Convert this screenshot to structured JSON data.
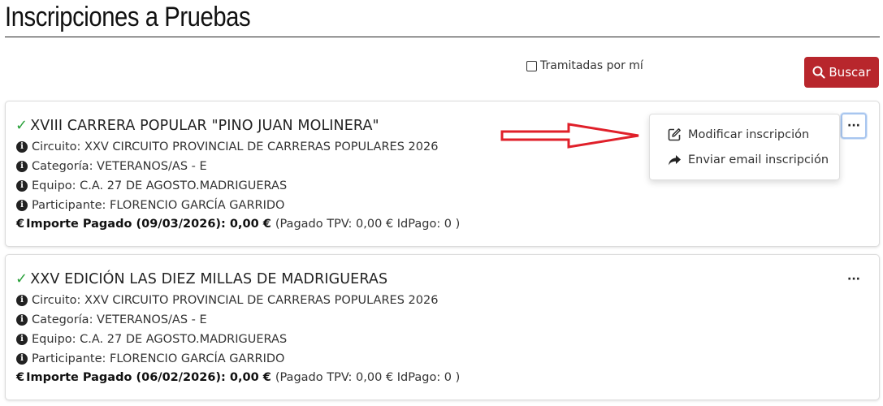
{
  "header": {
    "title": "Inscripciones a Pruebas"
  },
  "filters": {
    "checkbox_label": "Tramitadas por mí",
    "search_label": "Buscar"
  },
  "cards": [
    {
      "title": "XVIII CARRERA POPULAR \"PINO JUAN MOLINERA\"",
      "circuito": "Circuito: XXV CIRCUITO  PROVINCIAL  DE CARRERAS  POPULARES 2026",
      "categoria": "Categoría: VETERANOS/AS -  E",
      "equipo": "Equipo: C.A. 27  DE AGOSTO.MADRIGUERAS",
      "participante": "Participante:  FLORENCIO GARCÍA GARRIDO",
      "importe_label": "Importe  Pagado (09/03/2026): 0,00 €",
      "importe_detail": "(Pagado TPV: 0,00 €  IdPago: 0 )"
    },
    {
      "title": "XXV  EDICIÓN  LAS  DIEZ  MILLAS  DE  MADRIGUERAS",
      "circuito": "Circuito: XXV CIRCUITO  PROVINCIAL  DE CARRERAS  POPULARES 2026",
      "categoria": "Categoría: VETERANOS/AS -  E",
      "equipo": "Equipo: C.A. 27  DE AGOSTO.MADRIGUERAS",
      "participante": "Participante:  FLORENCIO GARCÍA GARRIDO",
      "importe_label": "Importe  Pagado (06/02/2026): 0,00 €",
      "importe_detail": "(Pagado TPV: 0,00 €  IdPago: 0 )"
    }
  ],
  "dropdown": {
    "items": [
      {
        "label": "Modificar inscripción",
        "icon": "edit-icon"
      },
      {
        "label": "Enviar email inscripción",
        "icon": "share-icon"
      }
    ]
  },
  "icons": {
    "check": "✓",
    "info": "i",
    "euro": "€",
    "ellipsis": "···"
  },
  "colors": {
    "accent_button": "#b8262c",
    "check_green": "#2aa13b",
    "annotation_arrow": "#e0202a"
  }
}
